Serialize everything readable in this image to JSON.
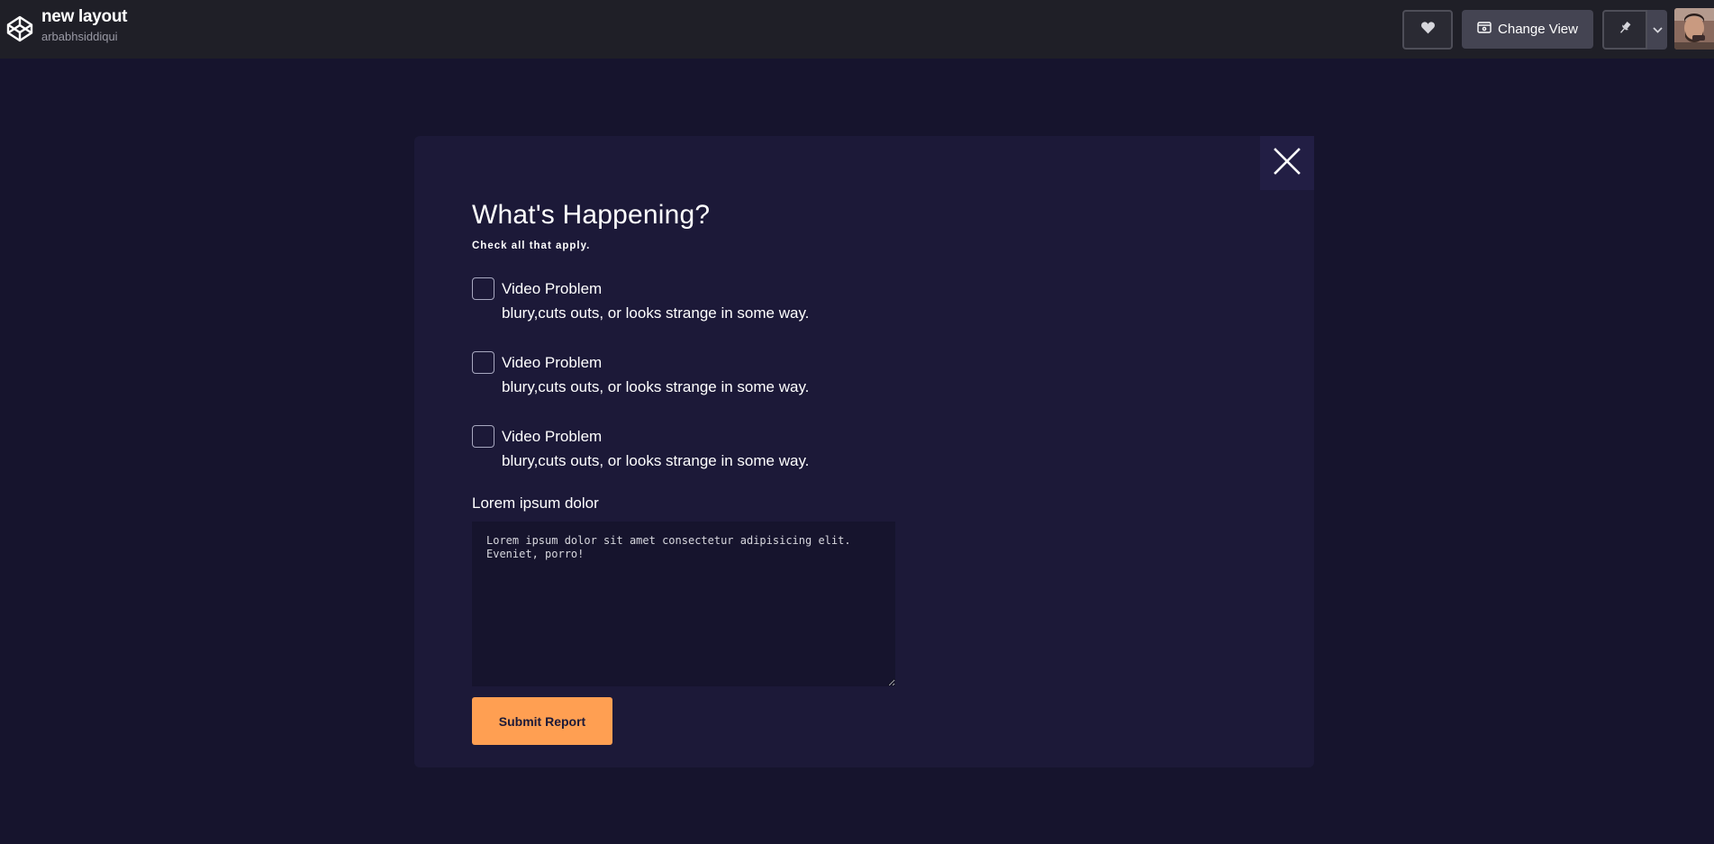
{
  "header": {
    "pen_title": "new layout",
    "author": "arbabhsiddiqui",
    "change_view_label": "Change View",
    "icons": {
      "logo": "codepen-logo-icon",
      "heart": "heart-icon",
      "change_view": "layout-view-icon",
      "pin": "pin-icon",
      "dropdown": "chevron-down-icon"
    }
  },
  "modal": {
    "close_icon": "close-icon",
    "heading": "What's Happening?",
    "subheading": "Check all that apply.",
    "options": [
      {
        "label": "Video Problem",
        "description": "blury,cuts outs, or looks strange in some way.",
        "checked": false
      },
      {
        "label": "Video Problem",
        "description": "blury,cuts outs, or looks strange in some way.",
        "checked": false
      },
      {
        "label": "Video Problem",
        "description": "blury,cuts outs, or looks strange in some way.",
        "checked": false
      }
    ],
    "comment_label": "Lorem ipsum dolor",
    "comment_value": "Lorem ipsum dolor sit amet consectetur adipisicing elit. Eveniet, porro!",
    "submit_label": "Submit Report"
  },
  "colors": {
    "page_background": "#16142d",
    "topbar_background": "#1f1f27",
    "modal_background": "#1c1938",
    "accent": "#ff9f52"
  }
}
